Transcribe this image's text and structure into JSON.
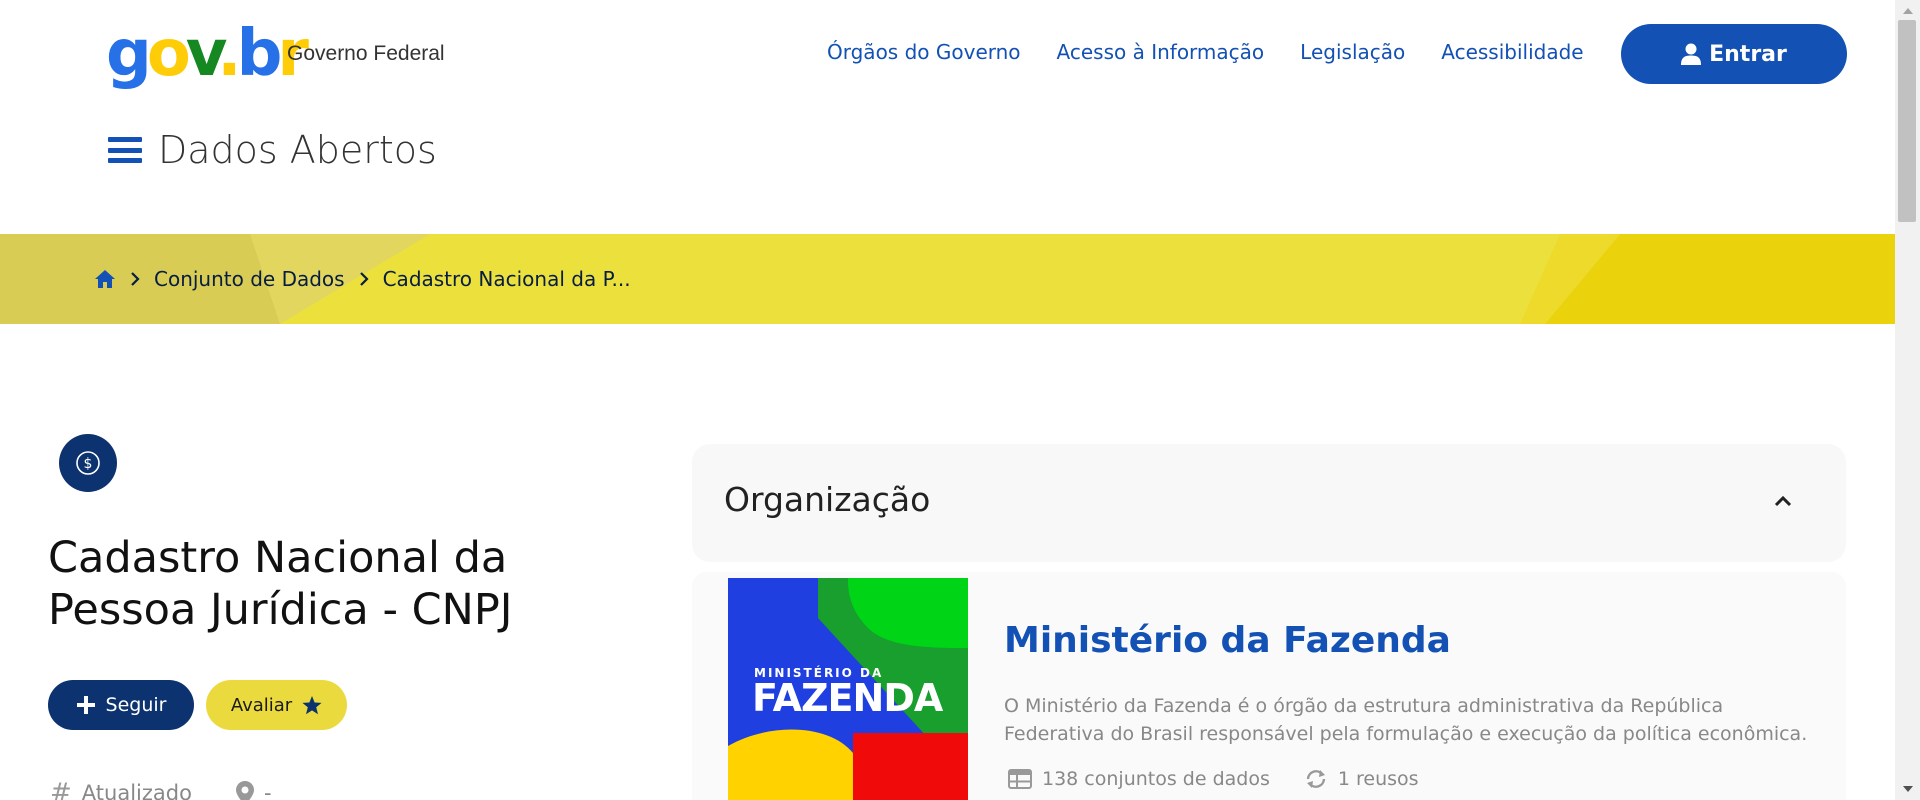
{
  "header": {
    "logo": {
      "text": "gov.br",
      "subtitle": "Governo Federal"
    },
    "nav": [
      {
        "label": "Órgãos do Governo"
      },
      {
        "label": "Acesso à Informação"
      },
      {
        "label": "Legislação"
      },
      {
        "label": "Acessibilidade"
      }
    ],
    "login_label": "Entrar",
    "site_title": "Dados Abertos"
  },
  "breadcrumb": {
    "items": [
      {
        "label": "Conjunto de Dados"
      },
      {
        "label": "Cadastro Nacional da P..."
      }
    ]
  },
  "dataset": {
    "title": "Cadastro Nacional da Pessoa Jurídica - CNPJ",
    "follow_label": "Seguir",
    "rate_label": "Avaliar",
    "meta_updated": "Atualizado",
    "meta_location": "-"
  },
  "organization": {
    "section_title": "Organização",
    "logo_small": "MINISTÉRIO DA",
    "logo_big": "FAZENDA",
    "name": "Ministério da Fazenda",
    "description": "O Ministério da Fazenda é o órgão da estrutura administrativa da República Federativa do Brasil responsável pela formulação e execução da política econômica.",
    "datasets_count": "138 conjuntos de dados",
    "reuses_count": "1 reusos"
  },
  "colors": {
    "primary": "#1351b4",
    "dark_blue": "#0c326f",
    "yellow": "#ebda3e",
    "banner_yellow": "#ece03d"
  },
  "icons": [
    "user-icon",
    "home-icon",
    "chevron-right-icon",
    "dollar-icon",
    "plus-icon",
    "star-icon",
    "hash-icon",
    "map-pin-icon",
    "chevron-up-icon",
    "table-icon",
    "refresh-icon"
  ]
}
